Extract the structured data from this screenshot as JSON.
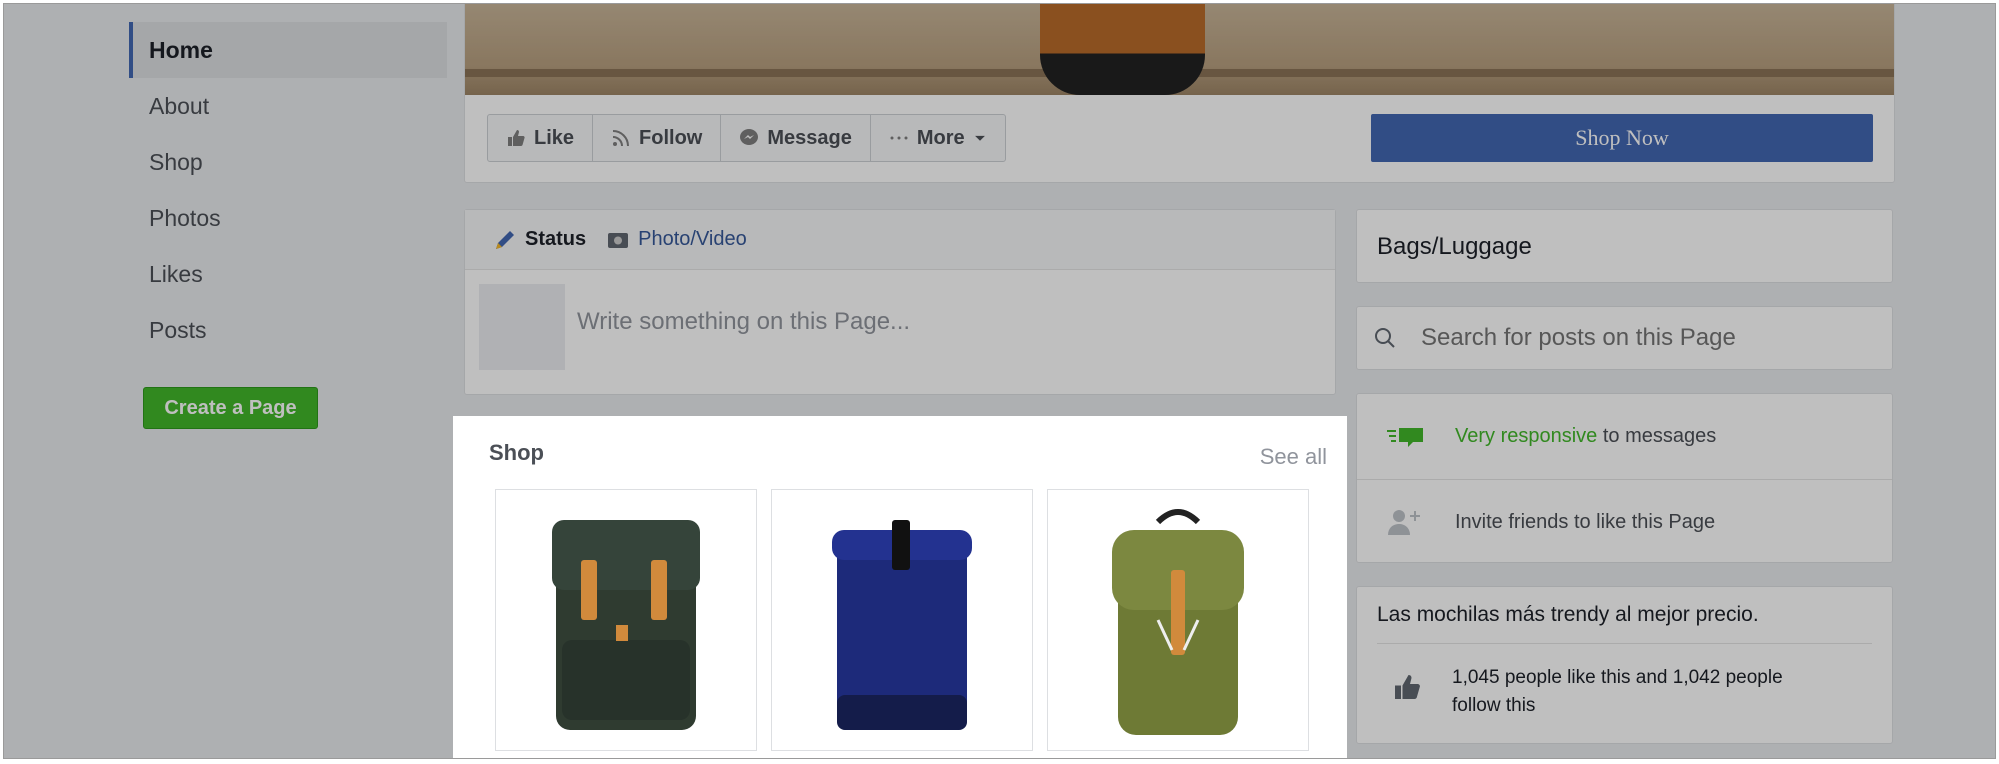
{
  "left_nav": {
    "items": [
      {
        "label": "Home",
        "active": true
      },
      {
        "label": "About"
      },
      {
        "label": "Shop"
      },
      {
        "label": "Photos"
      },
      {
        "label": "Likes"
      },
      {
        "label": "Posts"
      }
    ],
    "create_page_label": "Create a Page"
  },
  "actions": {
    "like": "Like",
    "follow": "Follow",
    "message": "Message",
    "more": "More",
    "shop_now": "Shop Now"
  },
  "composer": {
    "status_tab": "Status",
    "photo_video_tab": "Photo/Video",
    "placeholder": "Write something on this Page..."
  },
  "shop": {
    "title": "Shop",
    "see_all": "See all",
    "products": [
      {
        "color": "#2f3b30",
        "kind": "green-flap"
      },
      {
        "color": "#1d2a7a",
        "kind": "blue-rolltop"
      },
      {
        "color": "#6e7a35",
        "kind": "olive-drawstring"
      }
    ]
  },
  "sidebar": {
    "category": "Bags/Luggage",
    "search_placeholder": "Search for posts on this Page",
    "responsive_highlight": "Very responsive",
    "responsive_rest": " to messages",
    "invite_label": "Invite friends to like this Page",
    "tagline": "Las mochilas más trendy al mejor precio.",
    "likes_text_line1": "1,045 people like this and 1,042 people",
    "likes_text_line2": "follow this"
  },
  "colors": {
    "brand_blue": "#4267b2",
    "green": "#42b72a"
  }
}
